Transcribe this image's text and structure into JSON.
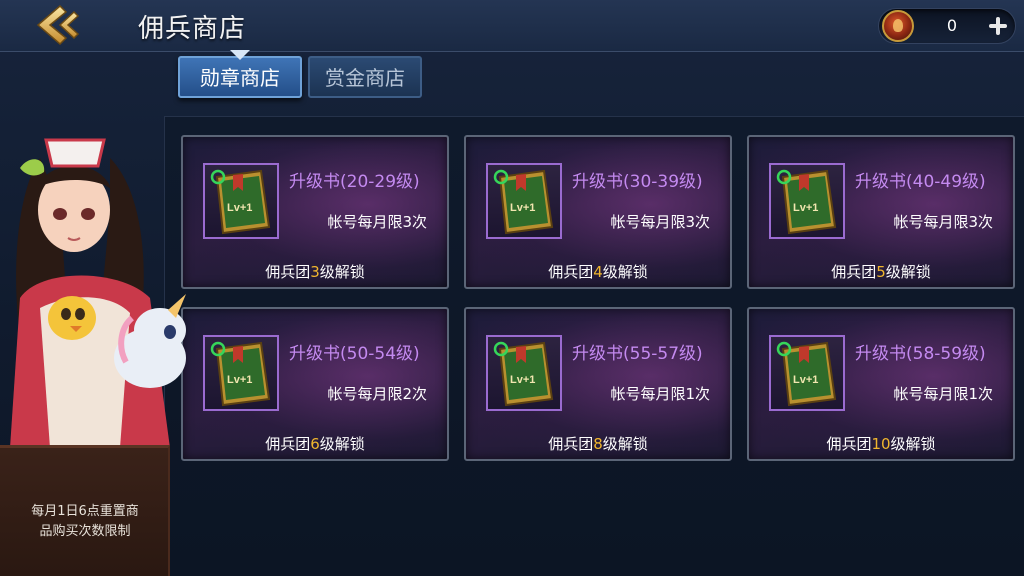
{
  "header": {
    "title": "佣兵商店",
    "currency": {
      "icon": "medal-icon",
      "amount": "0"
    }
  },
  "tabs": [
    {
      "label": "勋章商店",
      "active": true
    },
    {
      "label": "赏金商店",
      "active": false
    }
  ],
  "items": [
    {
      "name": "升级书(20-29级)",
      "limit": "帐号每月限3次",
      "unlock_prefix": "佣兵团",
      "unlock_level": "3",
      "unlock_suffix": "级解锁"
    },
    {
      "name": "升级书(30-39级)",
      "limit": "帐号每月限3次",
      "unlock_prefix": "佣兵团",
      "unlock_level": "4",
      "unlock_suffix": "级解锁"
    },
    {
      "name": "升级书(40-49级)",
      "limit": "帐号每月限3次",
      "unlock_prefix": "佣兵团",
      "unlock_level": "5",
      "unlock_suffix": "级解锁"
    },
    {
      "name": "升级书(50-54级)",
      "limit": "帐号每月限2次",
      "unlock_prefix": "佣兵团",
      "unlock_level": "6",
      "unlock_suffix": "级解锁"
    },
    {
      "name": "升级书(55-57级)",
      "limit": "帐号每月限1次",
      "unlock_prefix": "佣兵团",
      "unlock_level": "8",
      "unlock_suffix": "级解锁"
    },
    {
      "name": "升级书(58-59级)",
      "limit": "帐号每月限1次",
      "unlock_prefix": "佣兵团",
      "unlock_level": "10",
      "unlock_suffix": "级解锁"
    }
  ],
  "item_icon": {
    "name": "upgrade-book-icon",
    "label": "Lv+1"
  },
  "notice": {
    "line1": "每月1日6点重置商",
    "line2": "品购买次数限制"
  },
  "colors": {
    "item_name": "#c48af0",
    "unlock_level": "#f0b62e",
    "tab_active": "#3f74b6"
  }
}
